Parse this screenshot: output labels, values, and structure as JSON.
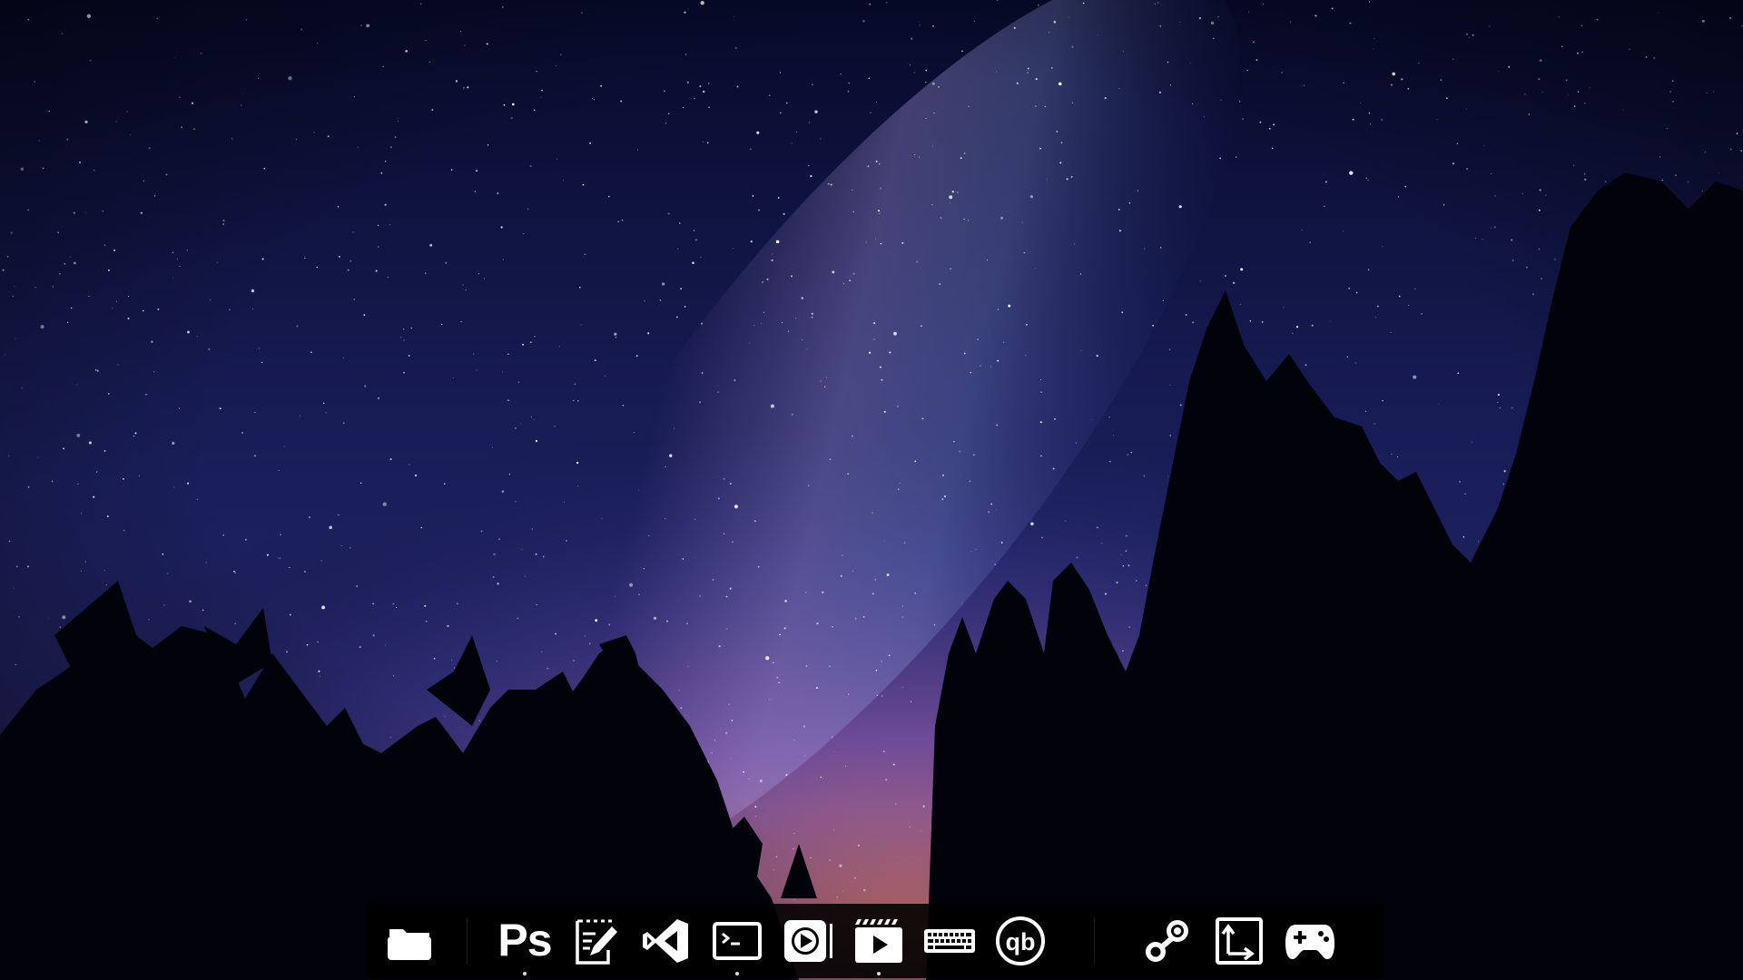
{
  "wallpaper": {
    "description_icon": "night-sky-milky-way-forest",
    "sky_colors": [
      "#05061a",
      "#1b2060",
      "#4a3f9a",
      "#8a5aa8",
      "#c9707e"
    ]
  },
  "dock": {
    "background": "#000000",
    "items": [
      {
        "icon": "folder-icon",
        "name": "files",
        "running": false
      },
      {
        "icon": "photoshop-icon",
        "name": "photoshop",
        "label": "Ps",
        "running": true
      },
      {
        "icon": "text-editor-icon",
        "name": "text-editor",
        "running": false
      },
      {
        "icon": "vscode-icon",
        "name": "vscode",
        "running": false
      },
      {
        "icon": "terminal-icon",
        "name": "terminal",
        "running": true
      },
      {
        "icon": "media-player-icon",
        "name": "media-player",
        "running": false
      },
      {
        "icon": "video-editor-icon",
        "name": "video-editor",
        "running": true
      },
      {
        "icon": "keyboard-icon",
        "name": "keyboard",
        "running": false
      },
      {
        "icon": "qbittorrent-icon",
        "name": "qbittorrent",
        "label": "qb",
        "running": false
      },
      {
        "icon": "steam-icon",
        "name": "steam",
        "running": false
      },
      {
        "icon": "resize-icon",
        "name": "resize",
        "running": false
      },
      {
        "icon": "gamepad-icon",
        "name": "game-controller",
        "running": false
      }
    ]
  }
}
